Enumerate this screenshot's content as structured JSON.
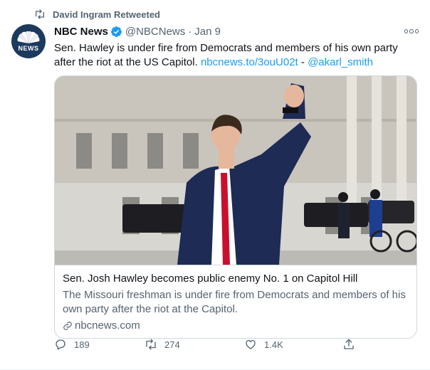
{
  "retweet": {
    "label": "David Ingram Retweeted"
  },
  "author": {
    "avatar_text": "NEWS",
    "name": "NBC News",
    "handle": "@NBCNews",
    "separator": "·",
    "date": "Jan 9"
  },
  "tweet": {
    "text": "Sen. Hawley is under fire from Democrats and members of his own party after the riot at the US Capitol.",
    "link": "nbcnews.to/3ouU02t",
    "link_separator": " - ",
    "mention": "@akarl_smith"
  },
  "card": {
    "title": "Sen. Josh Hawley becomes public enemy No. 1 on Capitol Hill",
    "description": "The Missouri freshman is under fire from Democrats and members of his own party after the riot at the Capitol.",
    "domain": "nbcnews.com"
  },
  "actions": {
    "replies": "189",
    "retweets": "274",
    "likes": "1.4K"
  },
  "colors": {
    "accent": "#1d9bf0",
    "muted": "#536471",
    "text": "#0f1419",
    "border": "#cfd9de"
  }
}
